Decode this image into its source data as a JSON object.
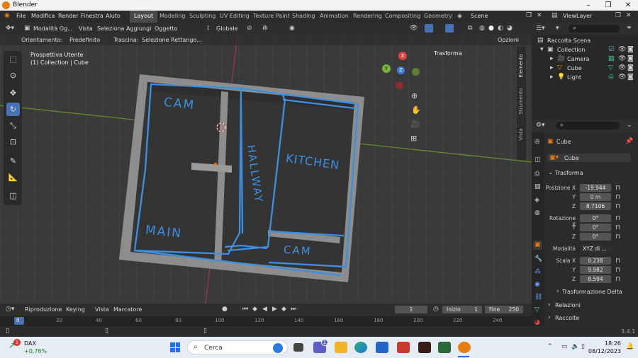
{
  "window": {
    "title": "Blender"
  },
  "menu": {
    "items": [
      "File",
      "Modifica",
      "Render",
      "Finestra",
      "Aiuto"
    ]
  },
  "workspaces": [
    "Layout",
    "Modeling",
    "Sculpting",
    "UV Editing",
    "Texture Paint",
    "Shading",
    "Animation",
    "Rendering",
    "Compositing",
    "Geometry"
  ],
  "scene": {
    "name": "Scene",
    "viewlayer": "ViewLayer"
  },
  "viewport_header": {
    "mode": "Modalità Og...",
    "items": [
      "Vista",
      "Seleziona",
      "Aggiungi",
      "Oggetto"
    ],
    "transform": "Globale"
  },
  "viewport_header2": {
    "orient_label": "Orientamento:",
    "orient_value": "Predefinito",
    "drag_label": "Trascina:",
    "drag_value": "Selezione Rettango...",
    "options": "Opzioni"
  },
  "viewport": {
    "perspective": "Prospettiva Utente",
    "collection": "(1) Collection | Cube",
    "n_panel": "Trasforma",
    "side_tabs": [
      "Elemento",
      "Strumento",
      "Vista"
    ],
    "drawing_labels": {
      "cam1": "CAM",
      "hallway": "HALLWAY",
      "kitchen": "KITCHEN",
      "main": "MAIN",
      "cam2": "CAM"
    }
  },
  "gizmo": {
    "x": "X",
    "y": "Y",
    "z": "Z"
  },
  "timeline": {
    "items": [
      "Riproduzione",
      "Keying",
      "Vista",
      "Marcatore"
    ],
    "frame": "1",
    "start_label": "Inizio",
    "start": "1",
    "end_label": "Fine",
    "end": "250",
    "ticks": [
      "0",
      "20",
      "40",
      "60",
      "80",
      "100",
      "120",
      "140",
      "160",
      "180",
      "200",
      "220",
      "240"
    ]
  },
  "status": {
    "version": "3.4.1"
  },
  "outliner": {
    "root": "Raccolta Scena",
    "collection": "Collection",
    "items": [
      "Camera",
      "Cube",
      "Light"
    ]
  },
  "properties": {
    "object_name": "Cube",
    "mesh_name": "Cube",
    "panel": "Trasforma",
    "location": {
      "label": "Posizione X",
      "x": "-19.944",
      "y": "0 m",
      "z": "8.7106"
    },
    "rotation": {
      "label": "Rotazione X",
      "x": "0°",
      "y": "0°",
      "z": "0°"
    },
    "mode_label": "Modalità",
    "mode": "XYZ di ...",
    "scale": {
      "label": "Scala X",
      "x": "0.238",
      "y": "9.982",
      "z": "8.594"
    },
    "axis_y": "Y",
    "axis_z": "Z",
    "sections": [
      "Trasformazione Delta",
      "Relazioni",
      "Raccolte"
    ]
  },
  "taskbar": {
    "widget_name": "DAX",
    "widget_value": "+0,78%",
    "widget_badge": "1",
    "search": "Cerca",
    "time": "18:26",
    "date": "08/12/2023",
    "chat_badge": "1"
  },
  "colors": {
    "accent": "#4772b3",
    "blender_orange": "#e87d0d",
    "sketch_blue": "#3d8fe0"
  }
}
